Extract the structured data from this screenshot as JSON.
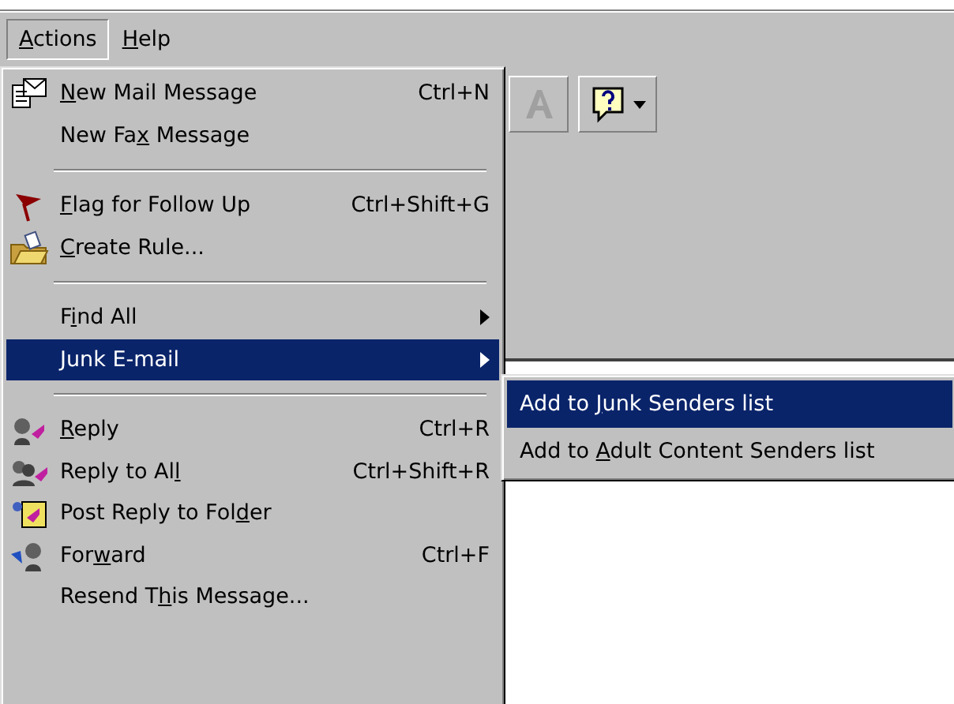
{
  "menu_bar": [
    {
      "label": {
        "key": "A",
        "post": "ctions"
      },
      "selected": true
    },
    {
      "label": {
        "key": "H",
        "post": "elp"
      },
      "selected": false
    }
  ],
  "actions_menu": [
    {
      "kind": "item",
      "label": {
        "key": "N",
        "post": "ew Mail Message"
      },
      "shortcut": "Ctrl+N",
      "selected": false,
      "submenu": false
    },
    {
      "kind": "item",
      "label": {
        "pre": "New Fa",
        "key": "x",
        "post": " Message"
      },
      "selected": false,
      "submenu": false
    },
    {
      "kind": "separator"
    },
    {
      "kind": "item",
      "label": {
        "key": "F",
        "post": "lag for Follow Up"
      },
      "shortcut": "Ctrl+Shift+G",
      "selected": false,
      "submenu": false
    },
    {
      "kind": "item",
      "label": {
        "key": "C",
        "post": "reate Rule..."
      },
      "selected": false,
      "submenu": false
    },
    {
      "kind": "separator"
    },
    {
      "kind": "item",
      "label": {
        "pre": "F",
        "key": "i",
        "post": "nd All"
      },
      "selected": false,
      "submenu": true
    },
    {
      "kind": "item",
      "label": {
        "key": "J",
        "post": "unk E-mail"
      },
      "selected": true,
      "submenu": true
    },
    {
      "kind": "separator"
    },
    {
      "kind": "item",
      "label": {
        "key": "R",
        "post": "eply"
      },
      "shortcut": "Ctrl+R",
      "selected": false,
      "submenu": false
    },
    {
      "kind": "item",
      "label": {
        "pre": "Reply to Al",
        "key": "l"
      },
      "shortcut": "Ctrl+Shift+R",
      "selected": false,
      "submenu": false
    },
    {
      "kind": "item",
      "label": {
        "pre": "Post Reply to Fol",
        "key": "d",
        "post": "er"
      },
      "selected": false,
      "submenu": false
    },
    {
      "kind": "item",
      "label": {
        "pre": "For",
        "key": "w",
        "post": "ard"
      },
      "shortcut": "Ctrl+F",
      "selected": false,
      "submenu": false
    },
    {
      "kind": "item",
      "label": {
        "pre": "Resend T",
        "key": "h",
        "post": "is Message..."
      },
      "selected": false,
      "submenu": false
    }
  ],
  "junk_submenu": [
    {
      "label": {
        "pre": "Add to ",
        "key": "J",
        "post": "unk Senders list"
      },
      "selected": true
    },
    {
      "label": {
        "pre": "Add to ",
        "key": "A",
        "post": "dult Content Senders list"
      },
      "selected": false
    }
  ]
}
